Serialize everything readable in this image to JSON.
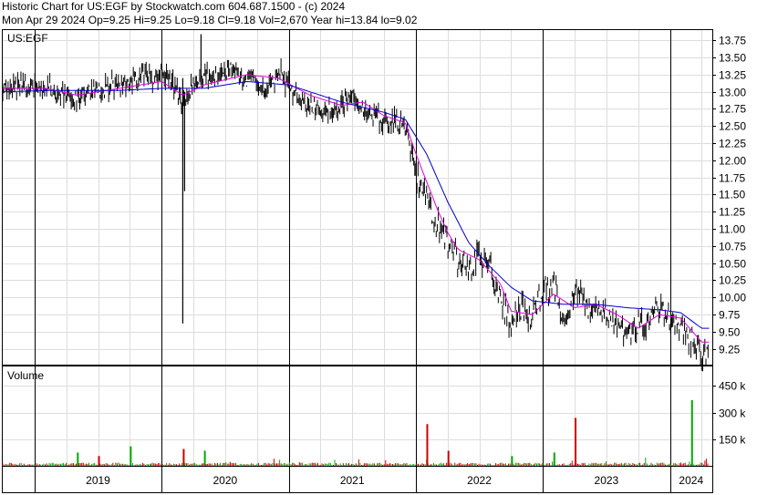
{
  "header": {
    "line1": "Historic Chart for US:EGF by Stockwatch.com 604.687.1500 - (c) 2024",
    "line2": "Mon Apr 29 2024  Op=9.25  Hi=9.25  Lo=9.18  Cl=9.18  Vol=2,670  Year hi=13.84  lo=9.02"
  },
  "chart_data": [
    {
      "type": "line",
      "title": "US:EGF",
      "y_ticks": [
        "13.75",
        "13.50",
        "13.25",
        "13.00",
        "12.75",
        "12.50",
        "12.25",
        "12.00",
        "11.75",
        "11.50",
        "11.25",
        "11.00",
        "10.75",
        "10.50",
        "10.25",
        "10.00",
        "9.75",
        "9.50",
        "9.25"
      ],
      "ylim": [
        9.02,
        13.9
      ],
      "x_labels": [
        "2019",
        "2020",
        "2021",
        "2022",
        "2023",
        "2024"
      ],
      "x_range": [
        "2018-10",
        "2024-05"
      ],
      "grid": true,
      "series": [
        {
          "color": "#000000",
          "points": [
            [
              "2018-10",
              13.05
            ],
            [
              "2018-12",
              13.08
            ],
            [
              "2019-02",
              13.1
            ],
            [
              "2019-03",
              13.0
            ],
            [
              "2019-05",
              12.9
            ],
            [
              "2019-07",
              13.05
            ],
            [
              "2019-09",
              13.1
            ],
            [
              "2019-11",
              13.2
            ],
            [
              "2020-01",
              13.25
            ],
            [
              "2020-02",
              13.1
            ],
            [
              "2020-03",
              12.8
            ],
            [
              "2020-04",
              13.1
            ],
            [
              "2020-05",
              13.2
            ],
            [
              "2020-07",
              13.3
            ],
            [
              "2020-09",
              13.2
            ],
            [
              "2020-11",
              13.05
            ],
            [
              "2020-12",
              13.3
            ],
            [
              "2021-02",
              12.9
            ],
            [
              "2021-04",
              12.7
            ],
            [
              "2021-06",
              12.8
            ],
            [
              "2021-07",
              13.0
            ],
            [
              "2021-08",
              12.7
            ],
            [
              "2021-10",
              12.6
            ],
            [
              "2021-11",
              12.6
            ],
            [
              "2021-12",
              12.5
            ],
            [
              "2022-01",
              11.8
            ],
            [
              "2022-02",
              11.5
            ],
            [
              "2022-03",
              11.1
            ],
            [
              "2022-04",
              10.8
            ],
            [
              "2022-05",
              10.55
            ],
            [
              "2022-06",
              10.4
            ],
            [
              "2022-07",
              10.6
            ],
            [
              "2022-08",
              10.5
            ],
            [
              "2022-09",
              10.0
            ],
            [
              "2022-10",
              9.6
            ],
            [
              "2022-11",
              9.9
            ],
            [
              "2022-12",
              9.7
            ],
            [
              "2023-01",
              10.1
            ],
            [
              "2023-02",
              10.2
            ],
            [
              "2023-03",
              9.6
            ],
            [
              "2023-04",
              10.1
            ],
            [
              "2023-05",
              9.9
            ],
            [
              "2023-06",
              9.8
            ],
            [
              "2023-07",
              9.8
            ],
            [
              "2023-08",
              9.6
            ],
            [
              "2023-09",
              9.4
            ],
            [
              "2023-10",
              9.6
            ],
            [
              "2023-11",
              9.7
            ],
            [
              "2023-12",
              9.8
            ],
            [
              "2024-01",
              9.7
            ],
            [
              "2024-02",
              9.6
            ],
            [
              "2024-03",
              9.4
            ],
            [
              "2024-04",
              9.2
            ]
          ]
        },
        {
          "color": "#e000e0",
          "points": [
            [
              "2018-10",
              13.05
            ],
            [
              "2019-02",
              13.05
            ],
            [
              "2019-05",
              12.95
            ],
            [
              "2019-09",
              13.05
            ],
            [
              "2020-01",
              13.15
            ],
            [
              "2020-03",
              12.95
            ],
            [
              "2020-05",
              13.1
            ],
            [
              "2020-09",
              13.25
            ],
            [
              "2020-12",
              13.2
            ],
            [
              "2021-03",
              12.95
            ],
            [
              "2021-06",
              12.8
            ],
            [
              "2021-08",
              12.85
            ],
            [
              "2021-10",
              12.65
            ],
            [
              "2021-12",
              12.55
            ],
            [
              "2022-01",
              12.1
            ],
            [
              "2022-02",
              11.7
            ],
            [
              "2022-03",
              11.3
            ],
            [
              "2022-04",
              10.95
            ],
            [
              "2022-05",
              10.7
            ],
            [
              "2022-07",
              10.55
            ],
            [
              "2022-09",
              10.2
            ],
            [
              "2022-10",
              9.8
            ],
            [
              "2022-12",
              9.75
            ],
            [
              "2023-02",
              10.05
            ],
            [
              "2023-04",
              9.85
            ],
            [
              "2023-06",
              9.9
            ],
            [
              "2023-08",
              9.75
            ],
            [
              "2023-10",
              9.55
            ],
            [
              "2023-12",
              9.75
            ],
            [
              "2024-02",
              9.7
            ],
            [
              "2024-04",
              9.35
            ]
          ]
        },
        {
          "color": "#0000cc",
          "points": [
            [
              "2018-10",
              13.0
            ],
            [
              "2019-03",
              13.02
            ],
            [
              "2019-09",
              13.02
            ],
            [
              "2020-01",
              13.05
            ],
            [
              "2020-05",
              13.05
            ],
            [
              "2020-09",
              13.15
            ],
            [
              "2021-01",
              13.1
            ],
            [
              "2021-06",
              12.85
            ],
            [
              "2021-10",
              12.7
            ],
            [
              "2021-12",
              12.6
            ],
            [
              "2022-02",
              12.1
            ],
            [
              "2022-04",
              11.4
            ],
            [
              "2022-06",
              10.8
            ],
            [
              "2022-08",
              10.45
            ],
            [
              "2022-10",
              10.15
            ],
            [
              "2022-12",
              9.95
            ],
            [
              "2023-03",
              9.9
            ],
            [
              "2023-06",
              9.9
            ],
            [
              "2023-09",
              9.85
            ],
            [
              "2023-12",
              9.82
            ],
            [
              "2024-02",
              9.78
            ],
            [
              "2024-04",
              9.55
            ]
          ]
        }
      ]
    },
    {
      "type": "bar",
      "title": "Volume",
      "y_ticks": [
        "450 k",
        "300 k",
        "150 k"
      ],
      "ylim": [
        0,
        560000
      ],
      "x_labels": [
        "2019",
        "2020",
        "2021",
        "2022",
        "2023",
        "2024"
      ],
      "spikes": [
        {
          "x": "2019-05",
          "value": 75000,
          "color": "#00aa00"
        },
        {
          "x": "2019-07",
          "value": 55000,
          "color": "#cc0000"
        },
        {
          "x": "2019-10",
          "value": 110000,
          "color": "#00aa00"
        },
        {
          "x": "2020-03",
          "value": 95000,
          "color": "#cc0000"
        },
        {
          "x": "2020-05",
          "value": 85000,
          "color": "#00aa00"
        },
        {
          "x": "2022-02",
          "value": 235000,
          "color": "#cc0000"
        },
        {
          "x": "2022-04",
          "value": 85000,
          "color": "#cc0000"
        },
        {
          "x": "2022-10",
          "value": 55000,
          "color": "#00aa00"
        },
        {
          "x": "2023-02",
          "value": 75000,
          "color": "#00aa00"
        },
        {
          "x": "2023-04",
          "value": 270000,
          "color": "#cc0000"
        },
        {
          "x": "2024-03",
          "value": 370000,
          "color": "#00aa00"
        }
      ]
    }
  ]
}
